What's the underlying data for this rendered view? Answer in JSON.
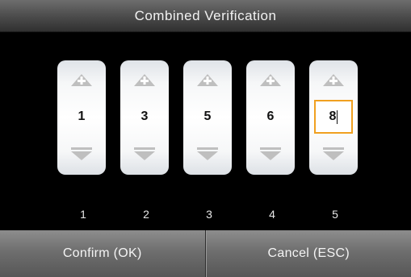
{
  "title": "Combined Verification",
  "digits": [
    {
      "value": "1",
      "index_label": "1",
      "active": false
    },
    {
      "value": "3",
      "index_label": "2",
      "active": false
    },
    {
      "value": "5",
      "index_label": "3",
      "active": false
    },
    {
      "value": "6",
      "index_label": "4",
      "active": false
    },
    {
      "value": "8",
      "index_label": "5",
      "active": true
    }
  ],
  "buttons": {
    "confirm_label": "Confirm (OK)",
    "cancel_label": "Cancel (ESC)"
  },
  "icons": {
    "increment": "plus-triangle-up-icon",
    "decrement": "triangle-down-icon"
  },
  "colors": {
    "active_border": "#f0a020",
    "background": "#000000"
  }
}
